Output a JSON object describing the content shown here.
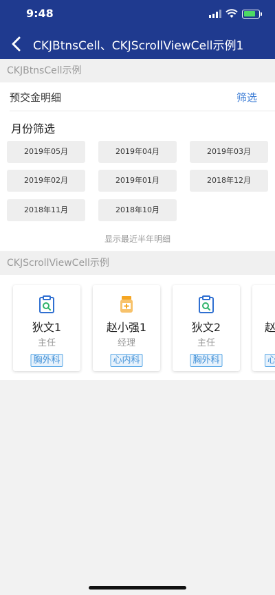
{
  "status_bar": {
    "time": "9:48"
  },
  "nav": {
    "title": "CKJBtnsCell、CKJScrollViewCell示例1"
  },
  "section1": {
    "header": "CKJBtnsCell示例",
    "row_label": "预交金明细",
    "filter_label": "筛选",
    "month_title": "月份筛选",
    "months": [
      "2019年05月",
      "2019年04月",
      "2019年03月",
      "2019年02月",
      "2019年01月",
      "2018年12月",
      "2018年11月",
      "2018年10月"
    ],
    "hint": "显示最近半年明细"
  },
  "section2": {
    "header": "CKJScrollViewCell示例",
    "cards": [
      {
        "name": "狄文1",
        "role": "主任",
        "dept": "胸外科",
        "icon": "clipboard-search-icon"
      },
      {
        "name": "赵小强1",
        "role": "经理",
        "dept": "心内科",
        "icon": "medicine-bottle-icon"
      },
      {
        "name": "狄文2",
        "role": "主任",
        "dept": "胸外科",
        "icon": "clipboard-search-icon"
      },
      {
        "name": "赵",
        "role": "",
        "dept": "心",
        "icon": "medicine-bottle-icon"
      }
    ]
  },
  "colors": {
    "nav_bg": "#1f3a8f",
    "accent": "#3a7bd5",
    "tag": "#3f8fd6"
  }
}
